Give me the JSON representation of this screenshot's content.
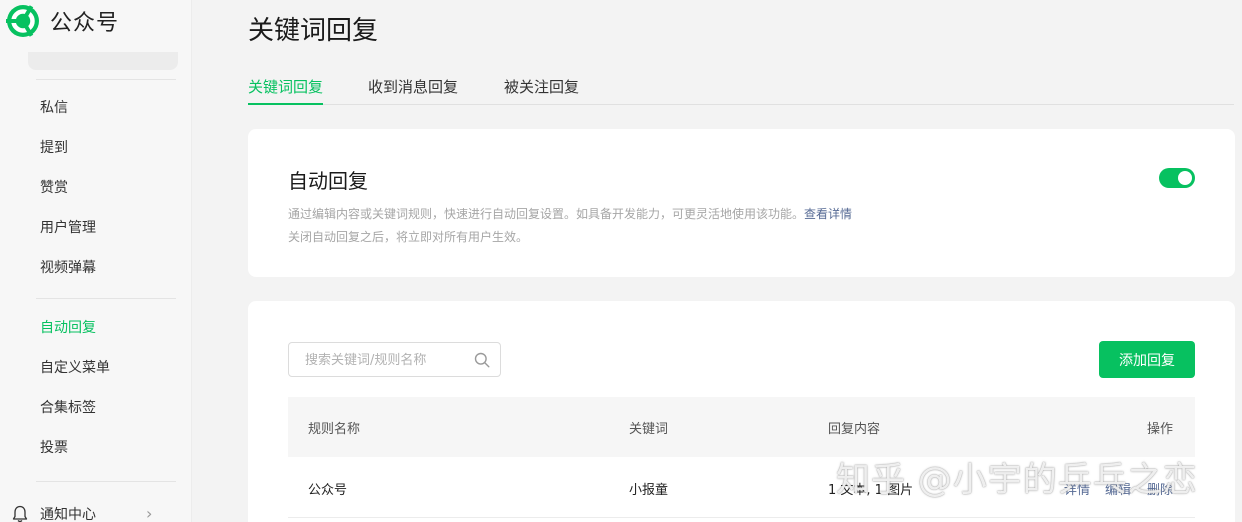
{
  "brand": {
    "name": "公众号",
    "logo_icon": "wechat-official-account-logo"
  },
  "sidebar": {
    "items": [
      {
        "label": "私信"
      },
      {
        "label": "提到"
      },
      {
        "label": "赞赏"
      },
      {
        "label": "用户管理"
      },
      {
        "label": "视频弹幕"
      },
      {
        "label": "自动回复",
        "active": true
      },
      {
        "label": "自定义菜单"
      },
      {
        "label": "合集标签"
      },
      {
        "label": "投票"
      }
    ],
    "notice": {
      "label": "通知中心",
      "icon": "bell-icon"
    }
  },
  "page": {
    "title": "关键词回复"
  },
  "tabs": [
    {
      "label": "关键词回复",
      "active": true
    },
    {
      "label": "收到消息回复"
    },
    {
      "label": "被关注回复"
    }
  ],
  "auto_reply": {
    "title": "自动回复",
    "desc_line1": "通过编辑内容或关键词规则，快速进行自动回复设置。如具备开发能力，可更灵活地使用该功能。",
    "desc_link": "查看详情",
    "desc_line2": "关闭自动回复之后，将立即对所有用户生效。",
    "enabled": true
  },
  "rules": {
    "search_placeholder": "搜索关键词/规则名称",
    "add_label": "添加回复",
    "columns": [
      "规则名称",
      "关键词",
      "回复内容",
      "操作"
    ],
    "rows": [
      {
        "name": "公众号",
        "keyword": "小报童",
        "content": "1 文本, 1 图片",
        "ops": [
          "详情",
          "编辑",
          "删除"
        ]
      }
    ]
  },
  "watermark": "知乎 @小宇的乒乓之恋",
  "colors": {
    "accent": "#07c160",
    "link": "#576b95"
  }
}
